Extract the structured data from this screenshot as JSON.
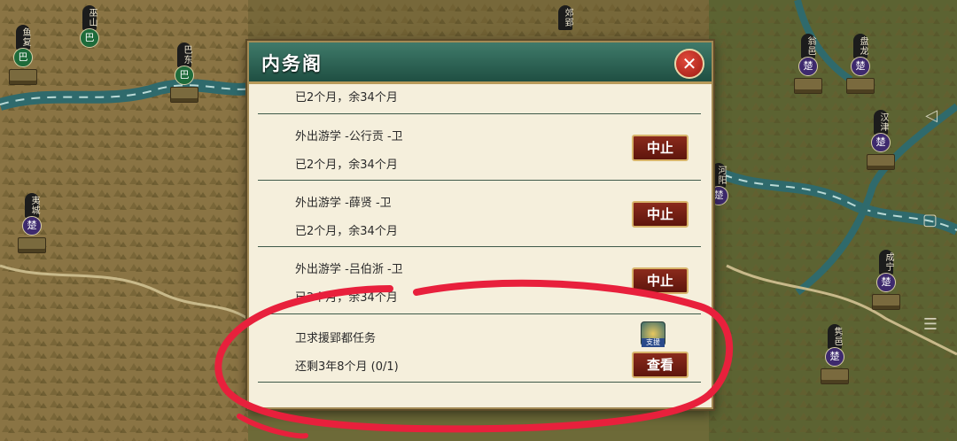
{
  "map": {
    "cities": [
      {
        "name": "鱼复",
        "seal": "巴",
        "faction": "ba"
      },
      {
        "name": "巫山",
        "seal": "巴",
        "faction": "ba"
      },
      {
        "name": "巴东",
        "seal": "巴",
        "faction": "ba"
      },
      {
        "name": "夷城",
        "seal": "楚",
        "faction": "chu"
      },
      {
        "name": "郊郢",
        "seal": "",
        "faction": "chu"
      },
      {
        "name": "翁邑",
        "seal": "楚",
        "faction": "chu"
      },
      {
        "name": "盘龙",
        "seal": "楚",
        "faction": "chu"
      },
      {
        "name": "汉津",
        "seal": "楚",
        "faction": "chu"
      },
      {
        "name": "河阳",
        "seal": "楚",
        "faction": "chu"
      },
      {
        "name": "成宁",
        "seal": "楚",
        "faction": "chu"
      },
      {
        "name": "隽邑",
        "seal": "楚",
        "faction": "chu"
      }
    ]
  },
  "panel": {
    "title": "内务阁",
    "close_label": "✕",
    "partial_row": "已2个月，余34个月",
    "rows": [
      {
        "line1": "外出游学 -公行贡 -卫",
        "line2": "已2个月，余34个月",
        "button": "中止"
      },
      {
        "line1": "外出游学 -薛贤 -卫",
        "line2": "已2个月，余34个月",
        "button": "中止"
      },
      {
        "line1": "外出游学 -吕伯浙 -卫",
        "line2": "已2个月，余34个月",
        "button": "中止"
      }
    ],
    "task": {
      "line1": "卫求援郢都任务",
      "line2": "还剩3年8个月 (0/1)",
      "button": "查看",
      "icon_label": "支援"
    }
  },
  "system_nav": {
    "back": "◁",
    "home": "▢",
    "menu": "☰"
  },
  "colors": {
    "panel_header": "#2e6556",
    "button_red": "#7a2216",
    "annotation": "#e8203c"
  }
}
